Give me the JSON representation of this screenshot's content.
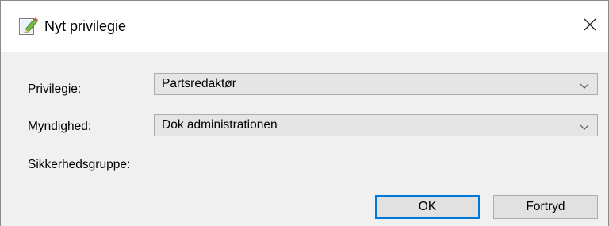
{
  "dialog": {
    "title": "Nyt privilegie",
    "icon": "edit-document-icon",
    "close": "close-icon"
  },
  "form": {
    "privilege_label": "Privilegie:",
    "privilege_value": "Partsredaktør",
    "authority_label": "Myndighed:",
    "authority_value": "Dok administrationen",
    "security_group_label": "Sikkerhedsgruppe:"
  },
  "buttons": {
    "ok": "OK",
    "cancel": "Fortryd"
  },
  "colors": {
    "accent": "#0078d7",
    "dialog_bg": "#f0f0f0",
    "combo_bg": "#e5e5e5",
    "button_bg": "#e1e1e1"
  }
}
